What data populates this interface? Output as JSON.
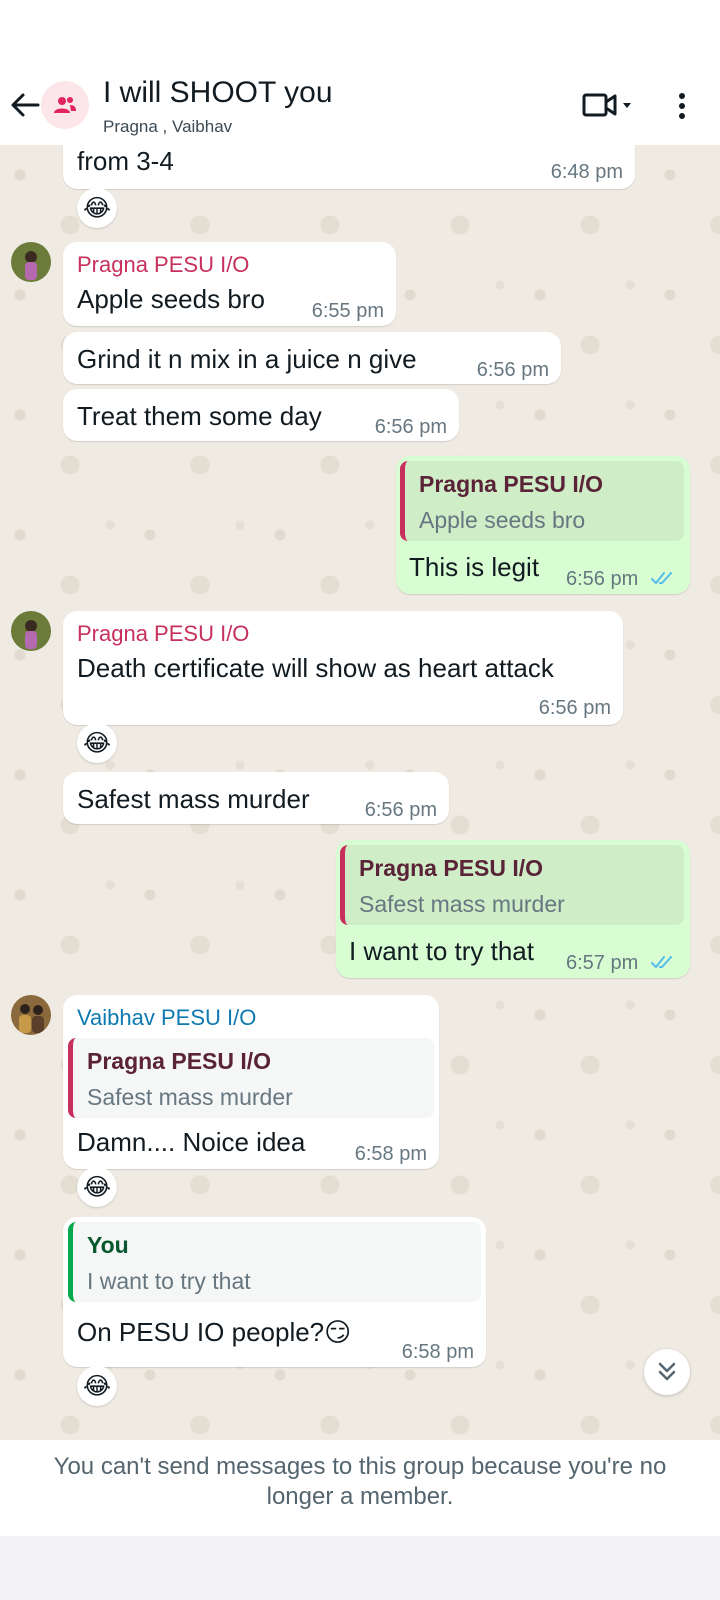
{
  "header": {
    "title": "I will SHOOT you",
    "participants": "Pragna , Vaibhav"
  },
  "messages": {
    "m0": {
      "text": "from 3-4",
      "time": "6:48 pm",
      "reaction": "😂"
    },
    "m1": {
      "sender": "Pragna PESU I/O",
      "text": "Apple seeds bro",
      "time": "6:55 pm"
    },
    "m2": {
      "text": "Grind it n mix in a juice n give",
      "time": "6:56 pm"
    },
    "m3": {
      "text": "Treat them some day",
      "time": "6:56 pm"
    },
    "m4": {
      "quote_sender": "Pragna PESU I/O",
      "quote_text": "Apple seeds bro",
      "text": "This is legit",
      "time": "6:56 pm"
    },
    "m5": {
      "sender": "Pragna PESU I/O",
      "text": "Death certificate will show as heart attack",
      "time": "6:56 pm",
      "reaction": "😂"
    },
    "m6": {
      "text": "Safest mass murder",
      "time": "6:56 pm"
    },
    "m7": {
      "quote_sender": "Pragna PESU I/O",
      "quote_text": "Safest mass murder",
      "text": "I want to try that",
      "time": "6:57 pm"
    },
    "m8": {
      "sender": "Vaibhav PESU I/O",
      "quote_sender": "Pragna PESU I/O",
      "quote_text": "Safest mass murder",
      "text": "Damn.... Noice idea",
      "time": "6:58 pm",
      "reaction": "😂"
    },
    "m9": {
      "quote_sender": "You",
      "quote_text": "I want to try that",
      "text": "On PESU IO people?😏",
      "time": "6:58 pm",
      "reaction": "😂"
    }
  },
  "colors": {
    "pragna": "#c7305d",
    "vaibhav": "#0e7ab2",
    "outgoing_bubble": "#d9fdd3",
    "read_ticks": "#53bdeb"
  },
  "footer": {
    "notice": "You can't send messages to this group because you're no longer a member."
  }
}
